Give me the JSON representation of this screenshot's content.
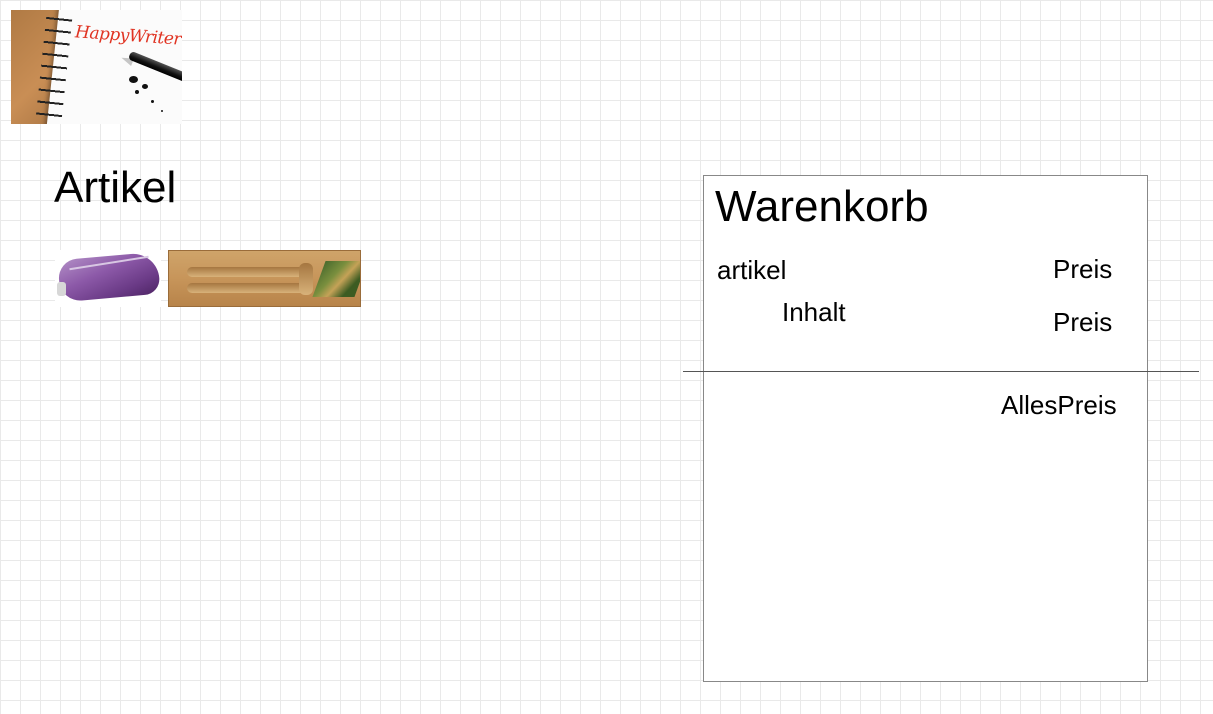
{
  "logo": {
    "text": "HappyWriter",
    "icon": "notebook-pen-logo"
  },
  "catalog": {
    "heading": "Artikel",
    "items": [
      {
        "icon": "purple-pencil-case-image"
      },
      {
        "icon": "wooden-pen-tray-image"
      }
    ]
  },
  "cart": {
    "title": "Warenkorb",
    "article_label": "artikel",
    "article_price": "Preis",
    "content_label": "Inhalt",
    "content_price": "Preis",
    "total_price": "AllesPreis"
  }
}
